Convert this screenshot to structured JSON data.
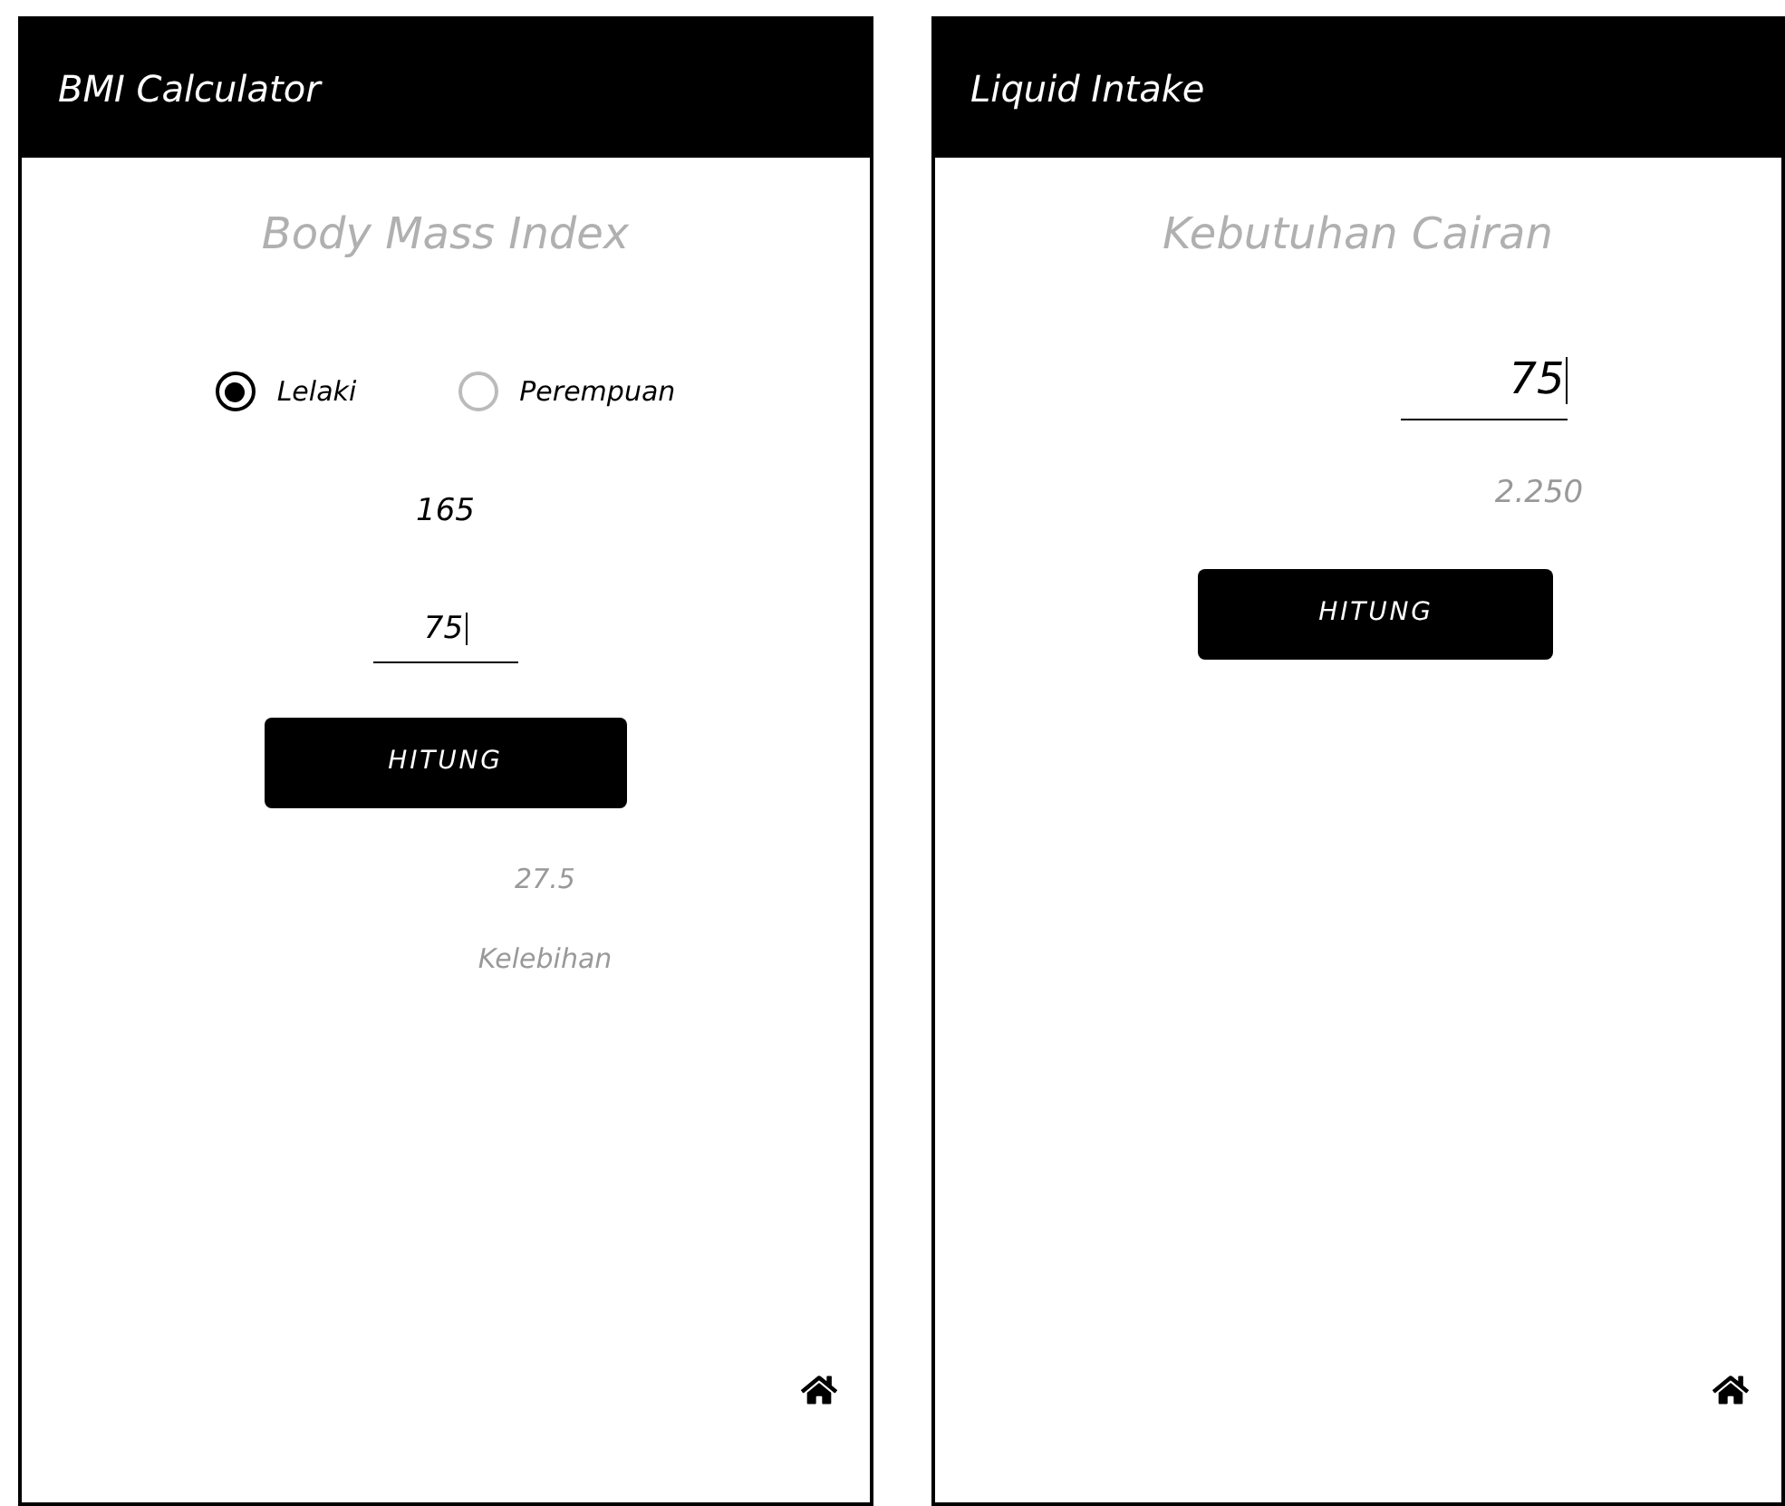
{
  "screens": [
    {
      "kind": "bmi",
      "title": "BMI Calculator",
      "heading": "Body Mass Index",
      "genders": [
        {
          "label": "Lelaki",
          "selected": true
        },
        {
          "label": "Perempuan",
          "selected": false
        }
      ],
      "height_value": "165",
      "weight_value": "75",
      "button": "HITUNG",
      "result_value": "27.5",
      "result_category": "Kelebihan"
    },
    {
      "kind": "liquid",
      "title": "Liquid Intake",
      "heading": "Kebutuhan Cairan",
      "weight_value": "75",
      "result_value": "2.250",
      "button": "HITUNG"
    }
  ]
}
